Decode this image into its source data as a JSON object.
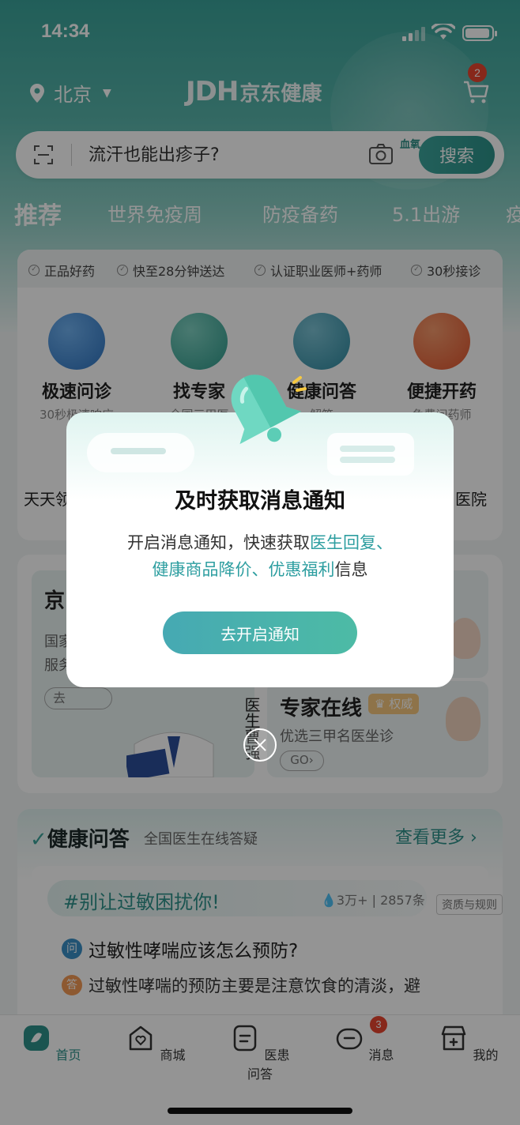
{
  "status": {
    "time": "14:34"
  },
  "header": {
    "location": "北京",
    "logo_latin": "JDH",
    "logo_cn": "京东健康",
    "cart_badge": "2"
  },
  "search": {
    "placeholder": "流汗也能出疹子?",
    "camera_tag": "血氧",
    "button": "搜索"
  },
  "tabs": [
    "推荐",
    "世界免疫周",
    "防疫备药",
    "5.1出游",
    "疫"
  ],
  "badges": [
    "正品好药",
    "快至28分钟送达",
    "认证职业医师+药师",
    "30秒接诊"
  ],
  "services": [
    {
      "name": "极速问诊",
      "sub": "30秒极速响应",
      "color": "#3b82c4"
    },
    {
      "name": "找专家",
      "sub": "全国三甲医",
      "color": "#3aa39a"
    },
    {
      "name": "健康问答",
      "sub": "解答",
      "color": "#3a8fa6"
    },
    {
      "name": "便捷开药",
      "sub": "免费问药师",
      "color": "#e8643a"
    }
  ],
  "services_row2": {
    "left": "天天领",
    "right": "医院"
  },
  "promo": {
    "left_title": "京",
    "left_sub_1": "国家",
    "left_sub_2": "服务",
    "left_go": "去",
    "doctor_sig": "医生曹强",
    "expert_title": "专家在线",
    "expert_tag": "权威",
    "expert_sub": "优选三甲名医坐诊",
    "expert_go": "GO"
  },
  "qa": {
    "title": "健康问答",
    "subtitle": "全国医生在线答疑",
    "more": "查看更多 ›",
    "topic": "#别让过敏困扰你!",
    "stats": "3万+ | 2857条",
    "rules": "资质与规则",
    "q_badge": "问",
    "question": "过敏性哮喘应该怎么预防?",
    "a_badge": "答",
    "answer": "过敏性哮喘的预防主要是注意饮食的清淡，避"
  },
  "nav": [
    {
      "label": "首页",
      "active": true
    },
    {
      "label": "商城"
    },
    {
      "label": "医患问答"
    },
    {
      "label": "消息",
      "badge": "3"
    },
    {
      "label": "我的"
    }
  ],
  "modal": {
    "title": "及时获取消息通知",
    "desc_prefix": "开启消息通知，快速获取",
    "desc_highlight_1": "医生回复、",
    "desc_highlight_2": "健康商品降价、优惠福利",
    "desc_suffix": "信息",
    "cta": "去开启通知"
  },
  "colors": {
    "accent": "#2d928a",
    "badge": "#e8452f",
    "cta": "#46a9b3"
  }
}
